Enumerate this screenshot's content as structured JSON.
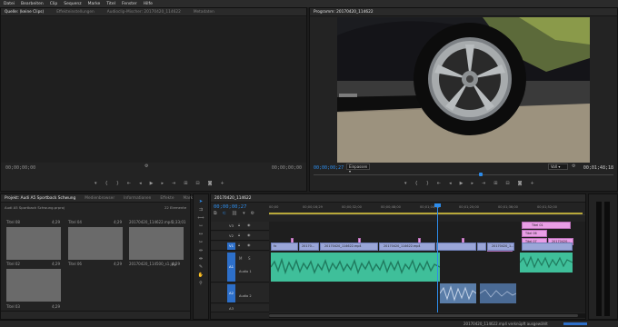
{
  "menu": [
    "Datei",
    "Bearbeiten",
    "Clip",
    "Sequenz",
    "Marke",
    "Titel",
    "Fenster",
    "Hilfe"
  ],
  "source_panel": {
    "tabs": [
      "Quelle: (keine Clips)",
      "Effekteinstellungen",
      "Audioclip-Mischer: 20170420_114622",
      "Metadaten"
    ],
    "timecode_left": "00;00;00;00",
    "timecode_right": "00;00;00;00"
  },
  "program_panel": {
    "tab": "Programm: 20170420_114622",
    "timecode": "00;00;00;27",
    "fit": "Einpassen",
    "quality": "Voll",
    "duration": "00;01;48;18"
  },
  "project_panel": {
    "tabs": [
      "Projekt: Audi A5 Sportback Schwung",
      "Medienbrowser",
      "Informationen",
      "Effekte",
      "Marker"
    ],
    "file": "Audi A5 Sportback Schwung.prproj",
    "count": "22 Elemente",
    "items": [
      {
        "name": "Titel 08",
        "dur": "4;29"
      },
      {
        "name": "Titel 04",
        "dur": "4;29"
      },
      {
        "name": "20170420_114622.mp4",
        "dur": "1;33;01"
      },
      {
        "name": "Titel 02",
        "dur": "4;29"
      },
      {
        "name": "Titel 06",
        "dur": "4;29"
      },
      {
        "name": "20170420_114500_s1.jpg",
        "dur": "4;29"
      },
      {
        "name": "Titel 03",
        "dur": "4;29"
      }
    ]
  },
  "timeline": {
    "tab": "20170420_114622",
    "timecode": "00;00;00;27",
    "ruler": [
      "00;00",
      "00;00;16;29",
      "00;00;32;00",
      "00;00;48;00",
      "00;01;04;02",
      "00;01;20;00",
      "00;01;36;00",
      "00;01;52;00",
      "00;02;08;04",
      "00;02;24;00"
    ],
    "track_labels": [
      "V3",
      "V2",
      "V1",
      "A1",
      "A2",
      "A3"
    ],
    "audio_names": [
      "Audio 1",
      "Audio 2"
    ],
    "v2_titles": [
      "Titel 04",
      "Titel 03",
      "Titel 06",
      "Titel 07",
      "Titel 01",
      "20170420..."
    ],
    "v1_clips": [
      "fx",
      "20170...",
      "20170420_114622.mp4",
      "20170420_114622.mp4",
      "20170420_1..."
    ],
    "status": "20170420_114622.mp4 verknüpft ausgewählt"
  },
  "colors": {
    "accent": "#2d8ceb",
    "video_clip": "#9aa6d8",
    "title_clip": "#e99ee6",
    "audio_clip": "#3fbf9a"
  }
}
